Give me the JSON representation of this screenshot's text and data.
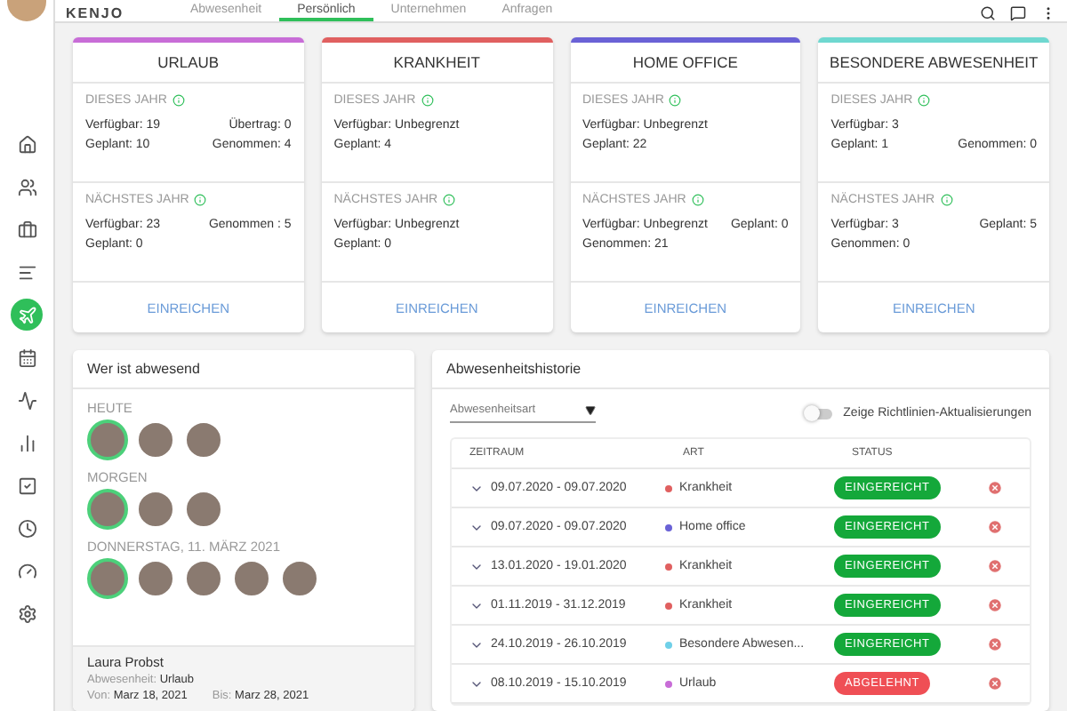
{
  "topbar": {
    "logo": "KENJO",
    "tabs": [
      {
        "label": "Abwesenheit",
        "selected": false
      },
      {
        "label": "Persönlich",
        "selected": true
      },
      {
        "label": "Unternehmen",
        "selected": false
      },
      {
        "label": "Anfragen",
        "selected": false
      }
    ]
  },
  "sidebar": {
    "items": [
      {
        "kind": "home",
        "selected": false
      },
      {
        "kind": "users",
        "selected": false
      },
      {
        "kind": "briefcase",
        "selected": false
      },
      {
        "kind": "list",
        "selected": false
      },
      {
        "kind": "plane",
        "selected": true
      },
      {
        "kind": "calendar",
        "selected": false
      },
      {
        "kind": "activity",
        "selected": false
      },
      {
        "kind": "chart",
        "selected": false
      },
      {
        "kind": "check",
        "selected": false
      },
      {
        "kind": "clock",
        "selected": false
      },
      {
        "kind": "gauge",
        "selected": false
      },
      {
        "kind": "settings",
        "selected": false
      }
    ]
  },
  "cards": [
    {
      "title": "URLAUB",
      "color": "#c86dd7",
      "this_year": {
        "label": "DIESES JAHR",
        "rows": [
          {
            "left": "Verfügbar: 19",
            "right": "Übertrag: 0"
          },
          {
            "left": "Geplant: 10",
            "right": "Genommen: 4"
          }
        ]
      },
      "next_year": {
        "label": "NÄCHSTES JAHR",
        "rows": [
          {
            "left": "Verfügbar: 23",
            "right": "Genommen : 5"
          },
          {
            "left": "Geplant: 0"
          }
        ]
      },
      "button": "EINREICHEN"
    },
    {
      "title": "KRANKHEIT",
      "color": "#e06060",
      "this_year": {
        "label": "DIESES JAHR",
        "rows": [
          {
            "left": "Verfügbar: Unbegrenzt"
          },
          {
            "left": "Geplant: 4"
          }
        ]
      },
      "next_year": {
        "label": "NÄCHSTES JAHR",
        "rows": [
          {
            "left": "Verfügbar: Unbegrenzt"
          },
          {
            "left": "Geplant: 0"
          }
        ]
      },
      "button": "EINREICHEN"
    },
    {
      "title": "HOME OFFICE",
      "color": "#6a62d6",
      "this_year": {
        "label": "DIESES JAHR",
        "rows": [
          {
            "left": "Verfügbar: Unbegrenzt"
          },
          {
            "left": "Geplant: 22"
          }
        ]
      },
      "next_year": {
        "label": "NÄCHSTES JAHR",
        "rows": [
          {
            "left": "Verfügbar: Unbegrenzt",
            "right": "Geplant: 0"
          },
          {
            "left": "Genommen: 21"
          }
        ]
      },
      "button": "EINREICHEN"
    },
    {
      "title": "BESONDERE ABWESENHEIT",
      "color": "#6fd8d0",
      "this_year": {
        "label": "DIESES JAHR",
        "rows": [
          {
            "left": "Verfügbar: 3"
          },
          {
            "left": "Geplant: 1",
            "right": "Genommen: 0"
          }
        ]
      },
      "next_year": {
        "label": "NÄCHSTES JAHR",
        "rows": [
          {
            "left": "Verfügbar: 3",
            "right": "Geplant: 5"
          },
          {
            "left": "Genommen: 0"
          }
        ]
      },
      "button": "EINREICHEN"
    }
  ],
  "absent": {
    "title": "Wer ist abwesend",
    "groups": [
      {
        "label": "HEUTE",
        "people": [
          {
            "selected": true
          },
          {
            "selected": false
          },
          {
            "selected": false
          }
        ]
      },
      {
        "label": "MORGEN",
        "people": [
          {
            "selected": true
          },
          {
            "selected": false
          },
          {
            "selected": false
          }
        ]
      },
      {
        "label": "DONNERSTAG, 11. MÄRZ 2021",
        "people": [
          {
            "selected": true
          },
          {
            "selected": false
          },
          {
            "selected": false
          },
          {
            "selected": false
          },
          {
            "selected": false
          }
        ]
      }
    ],
    "detail": {
      "name": "Laura Probst",
      "type_label": "Abwesenheit:",
      "type_value": "Urlaub",
      "from_label": "Von:",
      "from_value": "Marz 18, 2021",
      "to_label": "Bis:",
      "to_value": "Marz 28, 2021"
    }
  },
  "history": {
    "title": "Abwesenheitshistorie",
    "filter": {
      "placeholder": "Abwesenheitsart"
    },
    "toggle": {
      "label": "Zeige Richtlinien-Aktualisierungen",
      "on": false
    },
    "columns": [
      "ZEITRAUM",
      "ART",
      "STATUS"
    ],
    "rows": [
      {
        "period": "09.07.2020 - 09.07.2020",
        "type": "Krankheit",
        "color": "#e06060",
        "status": "EINGEREICHT",
        "kind": "submitted"
      },
      {
        "period": "09.07.2020 - 09.07.2020",
        "type": "Home office",
        "color": "#6a62d6",
        "status": "EINGEREICHT",
        "kind": "submitted"
      },
      {
        "period": "13.01.2020 - 19.01.2020",
        "type": "Krankheit",
        "color": "#e06060",
        "status": "EINGEREICHT",
        "kind": "submitted"
      },
      {
        "period": "01.11.2019 - 31.12.2019",
        "type": "Krankheit",
        "color": "#e06060",
        "status": "EINGEREICHT",
        "kind": "submitted"
      },
      {
        "period": "24.10.2019 - 26.10.2019",
        "type": "Besondere Abwesen...",
        "color": "#6fd0e8",
        "status": "EINGEREICHT",
        "kind": "submitted"
      },
      {
        "period": "08.10.2019 - 15.10.2019",
        "type": "Urlaub",
        "color": "#c86dd7",
        "status": "ABGELEHNT",
        "kind": "rejected"
      }
    ]
  }
}
